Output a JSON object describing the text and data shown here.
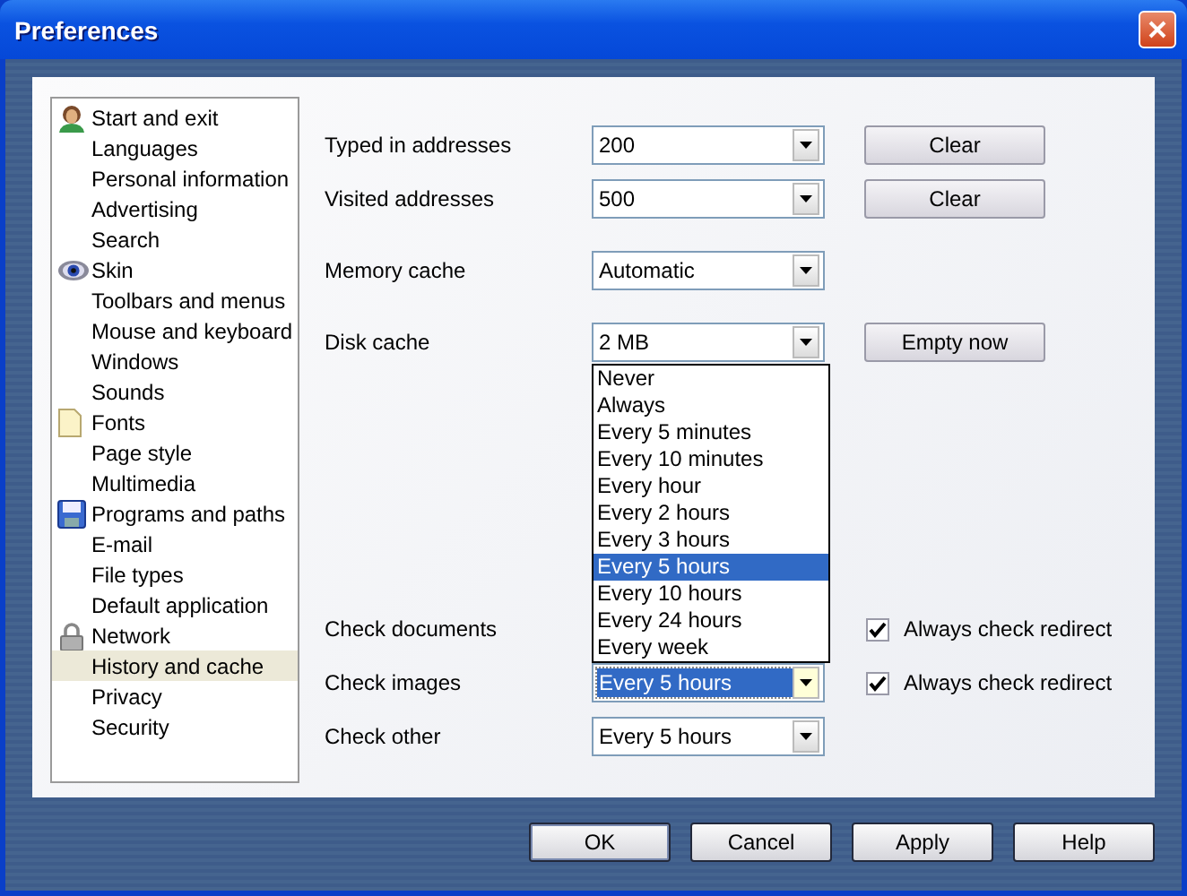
{
  "window": {
    "title": "Preferences"
  },
  "sidebar": {
    "groups": [
      {
        "label": "Start and exit",
        "selected": false,
        "children": [
          {
            "label": "Languages",
            "selected": false
          },
          {
            "label": "Personal information",
            "selected": false
          },
          {
            "label": "Advertising",
            "selected": false
          },
          {
            "label": "Search",
            "selected": false
          }
        ]
      },
      {
        "label": "Skin",
        "selected": false,
        "children": [
          {
            "label": "Toolbars and menus",
            "selected": false
          },
          {
            "label": "Mouse and keyboard",
            "selected": false
          },
          {
            "label": "Windows",
            "selected": false
          },
          {
            "label": "Sounds",
            "selected": false
          }
        ]
      },
      {
        "label": "Fonts",
        "selected": false,
        "children": [
          {
            "label": "Page style",
            "selected": false
          },
          {
            "label": "Multimedia",
            "selected": false
          }
        ]
      },
      {
        "label": "Programs and paths",
        "selected": false,
        "children": [
          {
            "label": "E-mail",
            "selected": false
          },
          {
            "label": "File types",
            "selected": false
          },
          {
            "label": "Default application",
            "selected": false
          }
        ]
      },
      {
        "label": "Network",
        "selected": false,
        "children": [
          {
            "label": "History and cache",
            "selected": true
          },
          {
            "label": "Privacy",
            "selected": false
          },
          {
            "label": "Security",
            "selected": false
          }
        ]
      }
    ]
  },
  "sections": [
    [
      {
        "label": "Typed in addresses",
        "value": "200",
        "focused": false,
        "button": "Clear"
      },
      {
        "label": "Visited addresses",
        "value": "500",
        "focused": false,
        "button": "Clear"
      }
    ],
    [
      {
        "label": "Memory cache",
        "value": "Automatic",
        "focused": false
      }
    ],
    [
      {
        "label": "Disk cache",
        "value": "2 MB",
        "focused": false,
        "button": "Empty now"
      }
    ],
    [
      {
        "label": "Check documents",
        "checkbox": {
          "label": "Always check redirect",
          "checked": true
        }
      },
      {
        "label": "Check images",
        "value": "Every 5 hours",
        "focused": true,
        "checkbox": {
          "label": "Always check redirect",
          "checked": true
        },
        "dropdown": [
          {
            "label": "Never",
            "selected": false
          },
          {
            "label": "Always",
            "selected": false
          },
          {
            "label": "Every 5 minutes",
            "selected": false
          },
          {
            "label": "Every 10 minutes",
            "selected": false
          },
          {
            "label": "Every hour",
            "selected": false
          },
          {
            "label": "Every 2 hours",
            "selected": false
          },
          {
            "label": "Every 3 hours",
            "selected": false
          },
          {
            "label": "Every 5 hours",
            "selected": true
          },
          {
            "label": "Every 10 hours",
            "selected": false
          },
          {
            "label": "Every 24 hours",
            "selected": false
          },
          {
            "label": "Every week",
            "selected": false
          }
        ]
      },
      {
        "label": "Check other",
        "value": "Every 5 hours",
        "focused": false
      }
    ]
  ],
  "buttons": [
    {
      "label": "OK",
      "default": true
    },
    {
      "label": "Cancel",
      "default": false
    },
    {
      "label": "Apply",
      "default": false
    },
    {
      "label": "Help",
      "default": false
    }
  ]
}
